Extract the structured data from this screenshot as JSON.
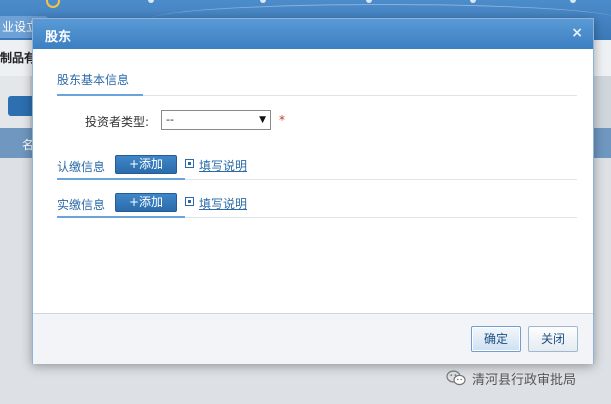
{
  "background": {
    "tab_label": "业设立",
    "subtitle": "制品有",
    "band_text": "名"
  },
  "dialog": {
    "title": "股东",
    "close_glyph": "×",
    "basic_info": {
      "label": "股东基本信息"
    },
    "investor_type": {
      "label": "投资者类型:",
      "selected": "--",
      "arrow": "▼",
      "required_mark": "*"
    },
    "subscribed": {
      "label": "认缴信息",
      "add_label": "+添加",
      "help_label": "填写说明"
    },
    "paid": {
      "label": "实缴信息",
      "add_label": "+添加",
      "help_label": "填写说明"
    },
    "footer": {
      "confirm_label": "确定",
      "close_label": "关闭"
    }
  },
  "watermark": {
    "text": "清河县行政审批局"
  },
  "colors": {
    "titlebar": "#3c7fc2",
    "accent": "#2a6aa8",
    "add_button": "#2b6cab",
    "required": "#c0392b"
  }
}
